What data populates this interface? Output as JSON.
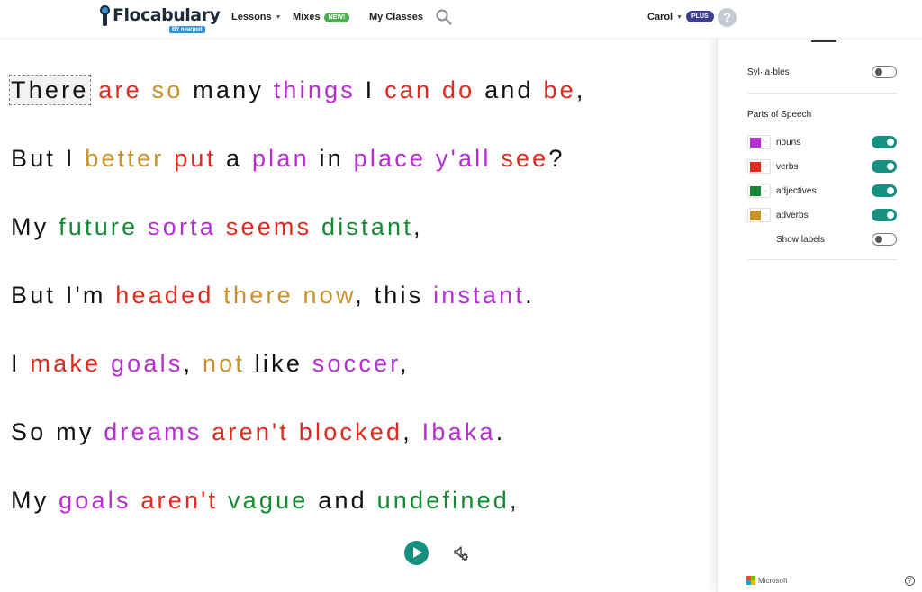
{
  "header": {
    "logo_text": "Flocabulary",
    "logo_sub": "BY nearpod",
    "nav": [
      {
        "label": "Lessons",
        "has_dropdown": true
      },
      {
        "label": "Mixes",
        "badge": "NEW!"
      },
      {
        "label": "My Classes"
      }
    ],
    "search_icon": "search-icon",
    "user_name": "Carol",
    "plan_badge": "PLUS",
    "help_label": "?"
  },
  "colors": {
    "nouns": "#b52fd0",
    "verbs": "#df2a20",
    "adjectives": "#148a35",
    "adverbs": "#c7922a",
    "accent": "#16917f"
  },
  "lyrics": [
    [
      {
        "t": "There",
        "pos": "none",
        "selected": true
      },
      {
        "t": " "
      },
      {
        "t": "are",
        "pos": "verb"
      },
      {
        "t": " "
      },
      {
        "t": "so",
        "pos": "adverb"
      },
      {
        "t": " many "
      },
      {
        "t": "things",
        "pos": "noun"
      },
      {
        "t": " I "
      },
      {
        "t": "can",
        "pos": "verb"
      },
      {
        "t": " "
      },
      {
        "t": "do",
        "pos": "verb"
      },
      {
        "t": " and "
      },
      {
        "t": "be",
        "pos": "verb"
      },
      {
        "t": ","
      }
    ],
    [
      {
        "t": "But I "
      },
      {
        "t": "better",
        "pos": "adverb"
      },
      {
        "t": " "
      },
      {
        "t": "put",
        "pos": "verb"
      },
      {
        "t": " a "
      },
      {
        "t": "plan",
        "pos": "noun"
      },
      {
        "t": " in "
      },
      {
        "t": "place",
        "pos": "noun"
      },
      {
        "t": " "
      },
      {
        "t": "y'all",
        "pos": "noun"
      },
      {
        "t": " "
      },
      {
        "t": "see",
        "pos": "verb"
      },
      {
        "t": "?"
      }
    ],
    [
      {
        "t": "My "
      },
      {
        "t": "future",
        "pos": "adjective"
      },
      {
        "t": " "
      },
      {
        "t": "sorta",
        "pos": "noun"
      },
      {
        "t": " "
      },
      {
        "t": "seems",
        "pos": "verb"
      },
      {
        "t": " "
      },
      {
        "t": "distant",
        "pos": "adjective"
      },
      {
        "t": ","
      }
    ],
    [
      {
        "t": "But I'm "
      },
      {
        "t": "headed",
        "pos": "verb"
      },
      {
        "t": " "
      },
      {
        "t": "there",
        "pos": "adverb"
      },
      {
        "t": " "
      },
      {
        "t": "now",
        "pos": "adverb"
      },
      {
        "t": ", this "
      },
      {
        "t": "instant",
        "pos": "noun"
      },
      {
        "t": "."
      }
    ],
    [
      {
        "t": "I "
      },
      {
        "t": "make",
        "pos": "verb"
      },
      {
        "t": " "
      },
      {
        "t": "goals",
        "pos": "noun"
      },
      {
        "t": ", "
      },
      {
        "t": "not",
        "pos": "adverb"
      },
      {
        "t": " like "
      },
      {
        "t": "soccer",
        "pos": "noun"
      },
      {
        "t": ","
      }
    ],
    [
      {
        "t": "So my "
      },
      {
        "t": "dreams",
        "pos": "noun"
      },
      {
        "t": " "
      },
      {
        "t": "aren't",
        "pos": "verb"
      },
      {
        "t": " "
      },
      {
        "t": "blocked",
        "pos": "verb"
      },
      {
        "t": ", "
      },
      {
        "t": "Ibaka",
        "pos": "noun"
      },
      {
        "t": "."
      }
    ],
    [
      {
        "t": "My "
      },
      {
        "t": "goals",
        "pos": "noun"
      },
      {
        "t": " "
      },
      {
        "t": "aren't",
        "pos": "verb"
      },
      {
        "t": " "
      },
      {
        "t": "vague",
        "pos": "adjective"
      },
      {
        "t": " and "
      },
      {
        "t": "undefined",
        "pos": "adjective"
      },
      {
        "t": ","
      }
    ]
  ],
  "player": {
    "play_icon": "play-icon",
    "audio_settings_icon": "audio-settings-icon"
  },
  "panel": {
    "syllables_label": "Syl·la·bles",
    "syllables_on": false,
    "parts_title": "Parts of Speech",
    "parts": [
      {
        "label": "nouns",
        "color": "#b52fd0",
        "on": true
      },
      {
        "label": "verbs",
        "color": "#df2a20",
        "on": true
      },
      {
        "label": "adjectives",
        "color": "#148a35",
        "on": true
      },
      {
        "label": "adverbs",
        "color": "#c7922a",
        "on": true
      }
    ],
    "show_labels_label": "Show labels",
    "show_labels_on": false,
    "footer_brand": "Microsoft",
    "footer_help": "?"
  }
}
